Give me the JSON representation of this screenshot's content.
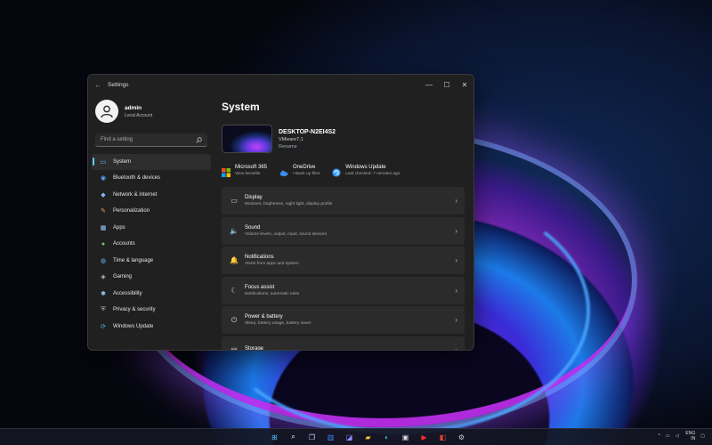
{
  "window": {
    "title": "Settings",
    "back_glyph": "←",
    "controls": {
      "minimize": "—",
      "maximize": "☐",
      "close": "✕"
    }
  },
  "user": {
    "name": "admin",
    "account_type": "Local Account"
  },
  "search": {
    "placeholder": "Find a setting",
    "icon": "search-icon"
  },
  "nav": [
    {
      "label": "System",
      "icon": "monitor-icon",
      "glyph": "▭",
      "active": true
    },
    {
      "label": "Bluetooth & devices",
      "icon": "bluetooth-icon",
      "glyph": "◉"
    },
    {
      "label": "Network & internet",
      "icon": "network-icon",
      "glyph": "◆"
    },
    {
      "label": "Personalization",
      "icon": "brush-icon",
      "glyph": "✎"
    },
    {
      "label": "Apps",
      "icon": "apps-icon",
      "glyph": "▦"
    },
    {
      "label": "Accounts",
      "icon": "person-icon",
      "glyph": "●"
    },
    {
      "label": "Time & language",
      "icon": "globe-icon",
      "glyph": "◍"
    },
    {
      "label": "Gaming",
      "icon": "controller-icon",
      "glyph": "◈"
    },
    {
      "label": "Accessibility",
      "icon": "accessibility-icon",
      "glyph": "✱"
    },
    {
      "label": "Privacy & security",
      "icon": "shield-icon",
      "glyph": "⛨"
    },
    {
      "label": "Windows Update",
      "icon": "update-icon",
      "glyph": "⟳"
    }
  ],
  "main": {
    "title": "System",
    "device": {
      "name": "DESKTOP-N2EI4S2",
      "model": "VMware7,1",
      "rename": "Rename"
    },
    "quick": [
      {
        "title": "Microsoft 365",
        "sub": "View benefits",
        "icon": "microsoft-365-icon"
      },
      {
        "title": "OneDrive",
        "sub": "• Back up files",
        "icon": "onedrive-icon"
      },
      {
        "title": "Windows Update",
        "sub": "Last checked: 7 minutes ago",
        "icon": "windows-update-icon"
      }
    ],
    "cards": [
      {
        "title": "Display",
        "sub": "Monitors, brightness, night light, display profile",
        "icon": "display-icon",
        "glyph": "▭"
      },
      {
        "title": "Sound",
        "sub": "Volume levels, output, input, sound devices",
        "icon": "speaker-icon",
        "glyph": "🔈"
      },
      {
        "title": "Notifications",
        "sub": "Alerts from apps and system",
        "icon": "bell-icon",
        "glyph": "🔔"
      },
      {
        "title": "Focus assist",
        "sub": "Notifications, automatic rules",
        "icon": "moon-icon",
        "glyph": "☾"
      },
      {
        "title": "Power & battery",
        "sub": "Sleep, battery usage, battery saver",
        "icon": "power-icon",
        "glyph": "⏻"
      },
      {
        "title": "Storage",
        "sub": "",
        "icon": "storage-icon",
        "glyph": "▤"
      }
    ],
    "chevron": "›"
  },
  "taskbar": {
    "apps": [
      {
        "name": "start-icon",
        "glyph": "⊞",
        "color": "#4cc2ff"
      },
      {
        "name": "search-icon",
        "glyph": "⌕",
        "color": "#ffffff"
      },
      {
        "name": "task-view-icon",
        "glyph": "❐",
        "color": "#cfd8ff"
      },
      {
        "name": "widgets-icon",
        "glyph": "▥",
        "color": "#3a8bff"
      },
      {
        "name": "chat-icon",
        "glyph": "◪",
        "color": "#8a8cff"
      },
      {
        "name": "file-explorer-icon",
        "glyph": "▰",
        "color": "#f4c542"
      },
      {
        "name": "edge-icon",
        "glyph": "◐",
        "color": "#2ec4b6"
      },
      {
        "name": "store-icon",
        "glyph": "▣",
        "color": "#dcdcdc"
      },
      {
        "name": "youtube-icon",
        "glyph": "▶",
        "color": "#ff2a2a"
      },
      {
        "name": "office-icon",
        "glyph": "◧",
        "color": "#e8452c"
      },
      {
        "name": "settings-icon",
        "glyph": "⚙",
        "color": "#c8c8c8"
      }
    ],
    "tray": {
      "chevron": "^",
      "lang_top": "ENG",
      "lang_bottom": "IN"
    }
  },
  "colors": {
    "accent": "#60cdff",
    "window_bg": "#202020",
    "card_bg": "#2b2b2b"
  }
}
